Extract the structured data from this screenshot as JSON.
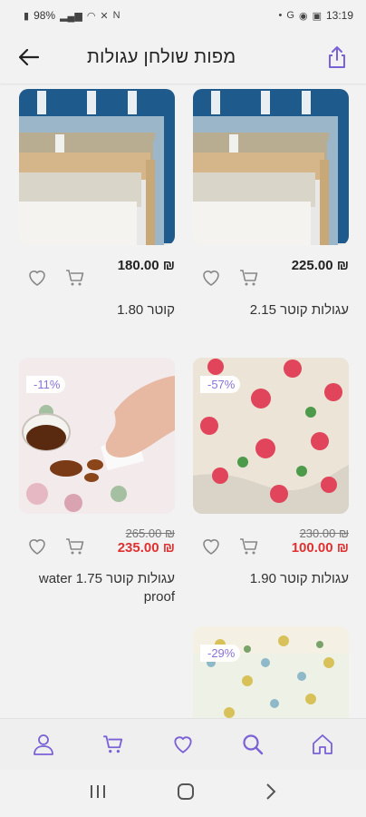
{
  "status": {
    "battery": "98%",
    "time": "13:19"
  },
  "header": {
    "title": "מפות שולחן עגולות"
  },
  "currency": "₪",
  "products": [
    {
      "name": "עגולות קוטר 2.15",
      "price": "225.00 ₪",
      "old_price": "",
      "discount": "",
      "image": "folded-tablecloths"
    },
    {
      "name": "קוטר 1.80",
      "price": "180.00 ₪",
      "old_price": "",
      "discount": "",
      "image": "folded-tablecloths"
    },
    {
      "name": "עגולות קוטר 1.90",
      "price": "100.00 ₪",
      "old_price": "230.00 ₪",
      "discount": "-57%",
      "image": "rose-tablecloth"
    },
    {
      "name": "עגולות קוטר 1.75 water proof",
      "price": "235.00 ₪",
      "old_price": "265.00 ₪",
      "discount": "-11%",
      "image": "spill-tablecloth"
    },
    {
      "name": "",
      "price": "",
      "old_price": "",
      "discount": "-29%",
      "image": "floral-tablecloth"
    }
  ],
  "colors": {
    "accent": "#7b61d6",
    "sale": "#e03030"
  }
}
